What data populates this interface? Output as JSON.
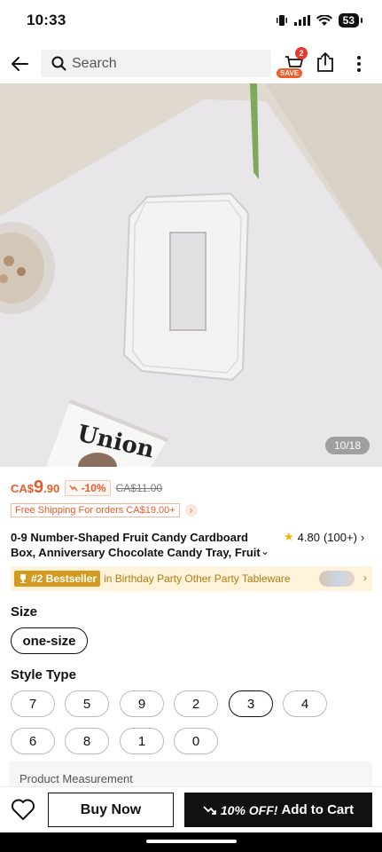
{
  "status_bar": {
    "time": "10:33",
    "battery": "53"
  },
  "nav": {
    "search_placeholder": "Search",
    "cart_count": "2",
    "save_label": "SAVE"
  },
  "image": {
    "counter": "10/18",
    "book_text": "Union"
  },
  "price": {
    "currency": "CA$",
    "main": "9",
    "cents": ".90",
    "discount": "-10%",
    "original": "CA$11.00"
  },
  "shipping": {
    "label": "Free Shipping For orders CA$19.00+"
  },
  "product": {
    "title": "0-9 Number-Shaped Fruit Candy Cardboard Box, Anniversary Chocolate Candy Tray, Fruit Biscuit",
    "rating": "4.80",
    "review_count": "(100+)"
  },
  "bestseller": {
    "badge": "#2 Bestseller",
    "text": "in Birthday Party Other Party Tableware"
  },
  "size": {
    "label": "Size",
    "selected": "one-size"
  },
  "style_type": {
    "label": "Style Type",
    "options": [
      "7",
      "5",
      "9",
      "2",
      "3",
      "4",
      "6",
      "8",
      "1",
      "0"
    ],
    "selected": "3"
  },
  "measurement": {
    "label": "Product Measurement"
  },
  "bottom": {
    "buy_now": "Buy Now",
    "discount_text": "10% OFF!",
    "add_to_cart": "Add to Cart"
  }
}
